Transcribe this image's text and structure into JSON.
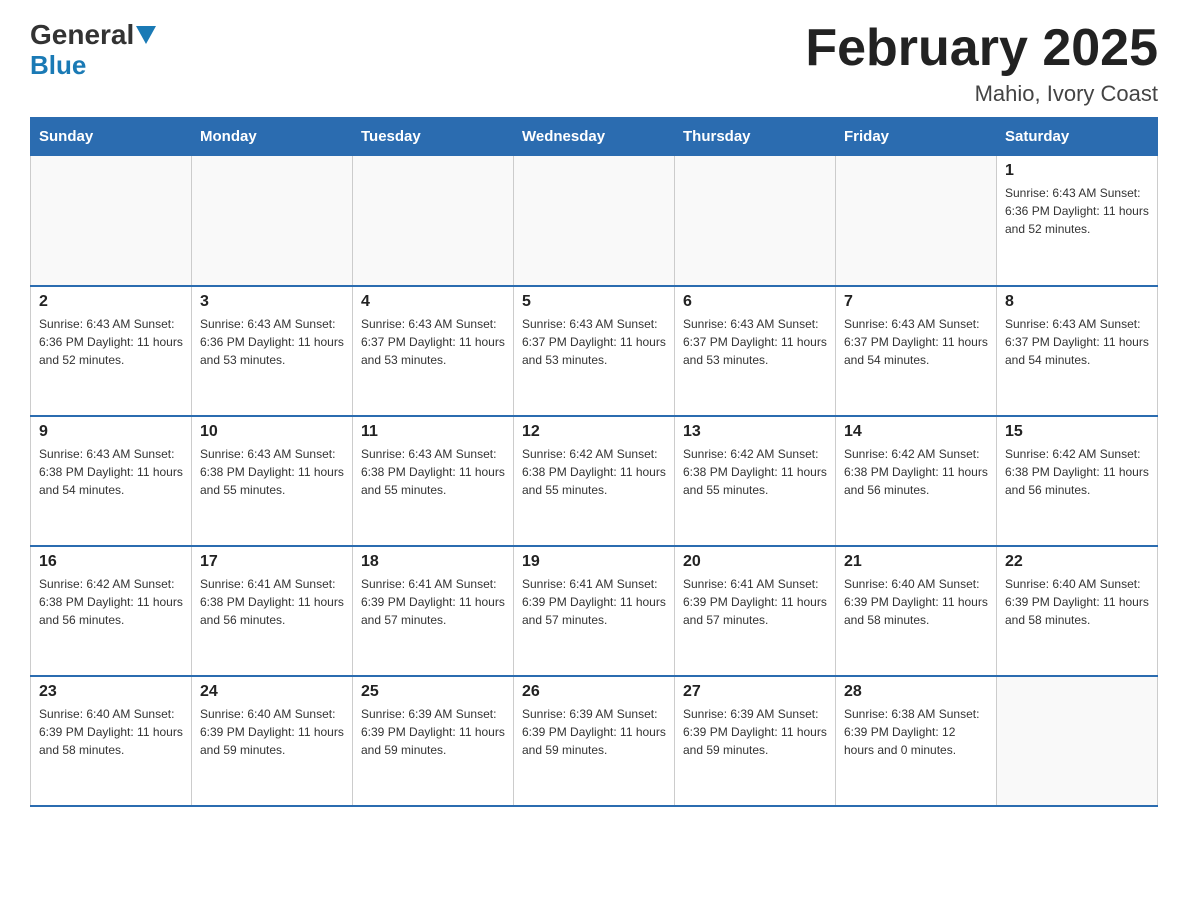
{
  "header": {
    "logo_general": "General",
    "logo_blue": "Blue",
    "title": "February 2025",
    "location": "Mahio, Ivory Coast"
  },
  "days_of_week": [
    "Sunday",
    "Monday",
    "Tuesday",
    "Wednesday",
    "Thursday",
    "Friday",
    "Saturday"
  ],
  "weeks": [
    {
      "days": [
        {
          "number": "",
          "info": ""
        },
        {
          "number": "",
          "info": ""
        },
        {
          "number": "",
          "info": ""
        },
        {
          "number": "",
          "info": ""
        },
        {
          "number": "",
          "info": ""
        },
        {
          "number": "",
          "info": ""
        },
        {
          "number": "1",
          "info": "Sunrise: 6:43 AM\nSunset: 6:36 PM\nDaylight: 11 hours\nand 52 minutes."
        }
      ]
    },
    {
      "days": [
        {
          "number": "2",
          "info": "Sunrise: 6:43 AM\nSunset: 6:36 PM\nDaylight: 11 hours\nand 52 minutes."
        },
        {
          "number": "3",
          "info": "Sunrise: 6:43 AM\nSunset: 6:36 PM\nDaylight: 11 hours\nand 53 minutes."
        },
        {
          "number": "4",
          "info": "Sunrise: 6:43 AM\nSunset: 6:37 PM\nDaylight: 11 hours\nand 53 minutes."
        },
        {
          "number": "5",
          "info": "Sunrise: 6:43 AM\nSunset: 6:37 PM\nDaylight: 11 hours\nand 53 minutes."
        },
        {
          "number": "6",
          "info": "Sunrise: 6:43 AM\nSunset: 6:37 PM\nDaylight: 11 hours\nand 53 minutes."
        },
        {
          "number": "7",
          "info": "Sunrise: 6:43 AM\nSunset: 6:37 PM\nDaylight: 11 hours\nand 54 minutes."
        },
        {
          "number": "8",
          "info": "Sunrise: 6:43 AM\nSunset: 6:37 PM\nDaylight: 11 hours\nand 54 minutes."
        }
      ]
    },
    {
      "days": [
        {
          "number": "9",
          "info": "Sunrise: 6:43 AM\nSunset: 6:38 PM\nDaylight: 11 hours\nand 54 minutes."
        },
        {
          "number": "10",
          "info": "Sunrise: 6:43 AM\nSunset: 6:38 PM\nDaylight: 11 hours\nand 55 minutes."
        },
        {
          "number": "11",
          "info": "Sunrise: 6:43 AM\nSunset: 6:38 PM\nDaylight: 11 hours\nand 55 minutes."
        },
        {
          "number": "12",
          "info": "Sunrise: 6:42 AM\nSunset: 6:38 PM\nDaylight: 11 hours\nand 55 minutes."
        },
        {
          "number": "13",
          "info": "Sunrise: 6:42 AM\nSunset: 6:38 PM\nDaylight: 11 hours\nand 55 minutes."
        },
        {
          "number": "14",
          "info": "Sunrise: 6:42 AM\nSunset: 6:38 PM\nDaylight: 11 hours\nand 56 minutes."
        },
        {
          "number": "15",
          "info": "Sunrise: 6:42 AM\nSunset: 6:38 PM\nDaylight: 11 hours\nand 56 minutes."
        }
      ]
    },
    {
      "days": [
        {
          "number": "16",
          "info": "Sunrise: 6:42 AM\nSunset: 6:38 PM\nDaylight: 11 hours\nand 56 minutes."
        },
        {
          "number": "17",
          "info": "Sunrise: 6:41 AM\nSunset: 6:38 PM\nDaylight: 11 hours\nand 56 minutes."
        },
        {
          "number": "18",
          "info": "Sunrise: 6:41 AM\nSunset: 6:39 PM\nDaylight: 11 hours\nand 57 minutes."
        },
        {
          "number": "19",
          "info": "Sunrise: 6:41 AM\nSunset: 6:39 PM\nDaylight: 11 hours\nand 57 minutes."
        },
        {
          "number": "20",
          "info": "Sunrise: 6:41 AM\nSunset: 6:39 PM\nDaylight: 11 hours\nand 57 minutes."
        },
        {
          "number": "21",
          "info": "Sunrise: 6:40 AM\nSunset: 6:39 PM\nDaylight: 11 hours\nand 58 minutes."
        },
        {
          "number": "22",
          "info": "Sunrise: 6:40 AM\nSunset: 6:39 PM\nDaylight: 11 hours\nand 58 minutes."
        }
      ]
    },
    {
      "days": [
        {
          "number": "23",
          "info": "Sunrise: 6:40 AM\nSunset: 6:39 PM\nDaylight: 11 hours\nand 58 minutes."
        },
        {
          "number": "24",
          "info": "Sunrise: 6:40 AM\nSunset: 6:39 PM\nDaylight: 11 hours\nand 59 minutes."
        },
        {
          "number": "25",
          "info": "Sunrise: 6:39 AM\nSunset: 6:39 PM\nDaylight: 11 hours\nand 59 minutes."
        },
        {
          "number": "26",
          "info": "Sunrise: 6:39 AM\nSunset: 6:39 PM\nDaylight: 11 hours\nand 59 minutes."
        },
        {
          "number": "27",
          "info": "Sunrise: 6:39 AM\nSunset: 6:39 PM\nDaylight: 11 hours\nand 59 minutes."
        },
        {
          "number": "28",
          "info": "Sunrise: 6:38 AM\nSunset: 6:39 PM\nDaylight: 12 hours\nand 0 minutes."
        },
        {
          "number": "",
          "info": ""
        }
      ]
    }
  ],
  "colors": {
    "header_bg": "#2b6cb0",
    "header_text": "#ffffff",
    "border": "#cccccc",
    "row_border": "#2b6cb0"
  }
}
